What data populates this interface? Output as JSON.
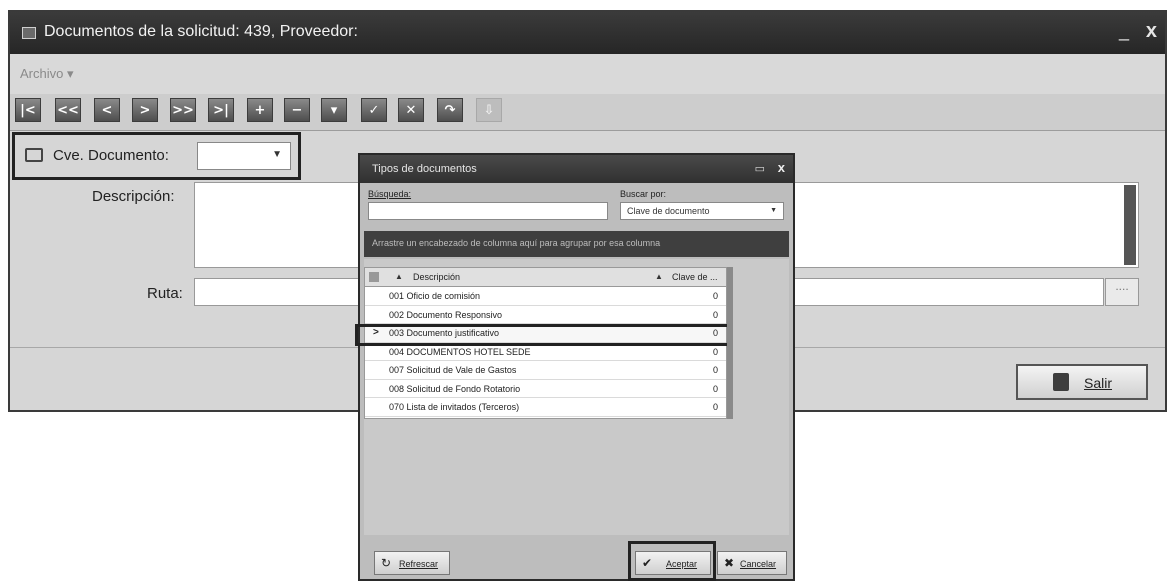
{
  "main_window": {
    "title": "Documentos de la solicitud: 439, Proveedor:",
    "minimize_glyph": "_",
    "close_glyph": "x",
    "menu": {
      "archivo": "Archivo ▾"
    },
    "toolbar": [
      {
        "name": "first-record-button",
        "glyph": "|<"
      },
      {
        "name": "prev-page-button",
        "glyph": "<<"
      },
      {
        "name": "prev-record-button",
        "glyph": "<"
      },
      {
        "name": "next-record-button",
        "glyph": ">"
      },
      {
        "name": "next-page-button",
        "glyph": ">>"
      },
      {
        "name": "last-record-button",
        "glyph": ">|"
      },
      {
        "name": "add-button",
        "glyph": "+"
      },
      {
        "name": "delete-button",
        "glyph": "−"
      },
      {
        "name": "edit-button",
        "glyph": "▾"
      },
      {
        "name": "confirm-button",
        "glyph": "✓"
      },
      {
        "name": "cancel-edit-button",
        "glyph": "✕"
      },
      {
        "name": "refresh-button",
        "glyph": "↷"
      },
      {
        "name": "import-button",
        "glyph": "⇩"
      }
    ],
    "form": {
      "cve_label": "Cve. Documento:",
      "cve_value": "",
      "descripcion_label": "Descripción:",
      "descripcion_value": "",
      "ruta_label": "Ruta:",
      "ruta_value": "",
      "ruta_browse": "...."
    },
    "salir_label": "Salir"
  },
  "dialog": {
    "title": "Tipos de documentos",
    "restore_glyph": "▭",
    "close_glyph": "x",
    "busqueda_label": "Búsqueda:",
    "busqueda_value": "",
    "buscar_por_label": "Buscar por:",
    "buscar_por_value": "Clave de documento",
    "group_hint": "Arrastre un encabezado de columna aquí para agrupar por esa columna",
    "columns": {
      "descripcion": "Descripción",
      "clave": "Clave de ..."
    },
    "rows": [
      {
        "descripcion": "001 Oficio de comisión",
        "clave": "0"
      },
      {
        "descripcion": "002 Documento Responsivo",
        "clave": "0"
      },
      {
        "descripcion": "003 Documento justificativo",
        "clave": "0"
      },
      {
        "descripcion": "004 DOCUMENTOS HOTEL SEDE",
        "clave": "0"
      },
      {
        "descripcion": "007 Solicitud de Vale de Gastos",
        "clave": "0"
      },
      {
        "descripcion": "008 Solicitud de Fondo Rotatorio",
        "clave": "0"
      },
      {
        "descripcion": "070 Lista de invitados (Terceros)",
        "clave": "0"
      }
    ],
    "selected_row_arrow": ">",
    "buttons": {
      "refrescar": "Refrescar",
      "aceptar": "Aceptar",
      "cancelar": "Cancelar"
    }
  }
}
